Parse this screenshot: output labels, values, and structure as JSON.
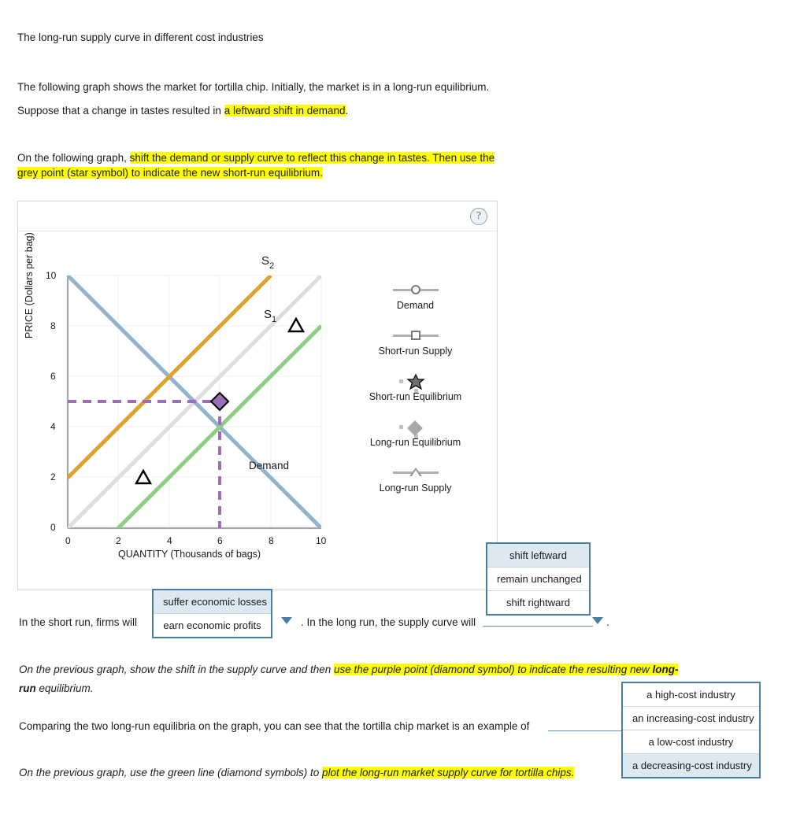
{
  "title": "The long-run supply curve in different cost industries",
  "intro": {
    "line1": "The following graph shows the market for tortilla chip. Initially, the market is in a long-run equilibrium.",
    "line2_pre": "Suppose that a change in tastes resulted in ",
    "line2_hl": "a leftward shift in demand",
    "line2_post": ".",
    "line3_pre": "On the following graph, ",
    "line3_hl_a": "shift the demand or supply curve to reflect this change in tastes. Then use the",
    "line3_hl_b": "grey point (star symbol) to indicate the new short-run equilibrium."
  },
  "panel": {
    "help_icon": "?"
  },
  "chart_data": {
    "type": "line",
    "title": "",
    "xlabel": "QUANTITY (Thousands of bags)",
    "ylabel": "PRICE (Dollars per bag)",
    "xlim": [
      0,
      10
    ],
    "ylim": [
      0,
      10
    ],
    "xticks": [
      "0",
      "2",
      "4",
      "6",
      "8",
      "10"
    ],
    "yticks": [
      "0",
      "2",
      "4",
      "6",
      "8",
      "10"
    ],
    "grid": true,
    "series": [
      {
        "name": "Demand",
        "label_on_plot": "Demand",
        "color": "#93b2cc",
        "points": [
          [
            0,
            10
          ],
          [
            10,
            0
          ]
        ]
      },
      {
        "name": "S1",
        "label_on_plot": "S",
        "label_sub": "1",
        "color": "#dedede",
        "points": [
          [
            0,
            0
          ],
          [
            10,
            10
          ]
        ]
      },
      {
        "name": "S2",
        "label_on_plot": "S",
        "label_sub": "2",
        "color": "#dda32e",
        "points": [
          [
            0,
            2
          ],
          [
            8,
            10
          ]
        ]
      },
      {
        "name": "Long-run Supply",
        "label_on_plot": "",
        "color": "#8ccf82",
        "points": [
          [
            2,
            0
          ],
          [
            10,
            8
          ]
        ],
        "markers": [
          [
            3,
            1
          ],
          [
            9,
            7
          ]
        ],
        "marker_shape": "triangle"
      }
    ],
    "points": [
      {
        "name": "Long-run Equilibrium",
        "shape": "diamond",
        "color": "#9b6fb5",
        "x": 6,
        "y": 5,
        "dashed_guides": true
      }
    ]
  },
  "legend": {
    "items": [
      {
        "label": "Demand",
        "glyph": "line-circle-icon"
      },
      {
        "label": "Short-run Supply",
        "glyph": "line-square-icon"
      },
      {
        "label": "Short-run Equilibrium",
        "glyph": "star-point-icon"
      },
      {
        "label": "Long-run Equilibrium",
        "glyph": "diamond-point-icon"
      },
      {
        "label": "Long-run Supply",
        "glyph": "line-triangle-icon"
      }
    ]
  },
  "question1": {
    "pre": "In the short run, firms will",
    "mid": ". In the long run, the supply curve will",
    "post": ".",
    "dropdown1": {
      "options": [
        "suffer economic losses",
        "earn economic profits"
      ],
      "selected_index": 0
    },
    "dropdown2": {
      "options": [
        "shift leftward",
        "remain unchanged",
        "shift rightward"
      ],
      "selected_index": 0
    }
  },
  "question2": {
    "line1_pre": "On the previous graph, show the shift in the supply curve and then ",
    "line1_hl_a": "use the purple point (diamond symbol) to indicate the resulting new ",
    "line1_hl_b": "long-",
    "line2_bold": "run",
    "line2_rest": " equilibrium."
  },
  "question3": {
    "text": "Comparing the two long-run equilibria on the graph, you can see that the tortilla chip market is an example of",
    "post": ".",
    "dropdown3": {
      "options": [
        "a high-cost industry",
        "an increasing-cost industry",
        "a low-cost industry",
        "a decreasing-cost industry"
      ],
      "selected_index": 3
    }
  },
  "question4": {
    "pre": "On the previous graph, use the green line (diamond symbols) to ",
    "hl": "plot the long-run market supply curve for tortilla chips."
  }
}
